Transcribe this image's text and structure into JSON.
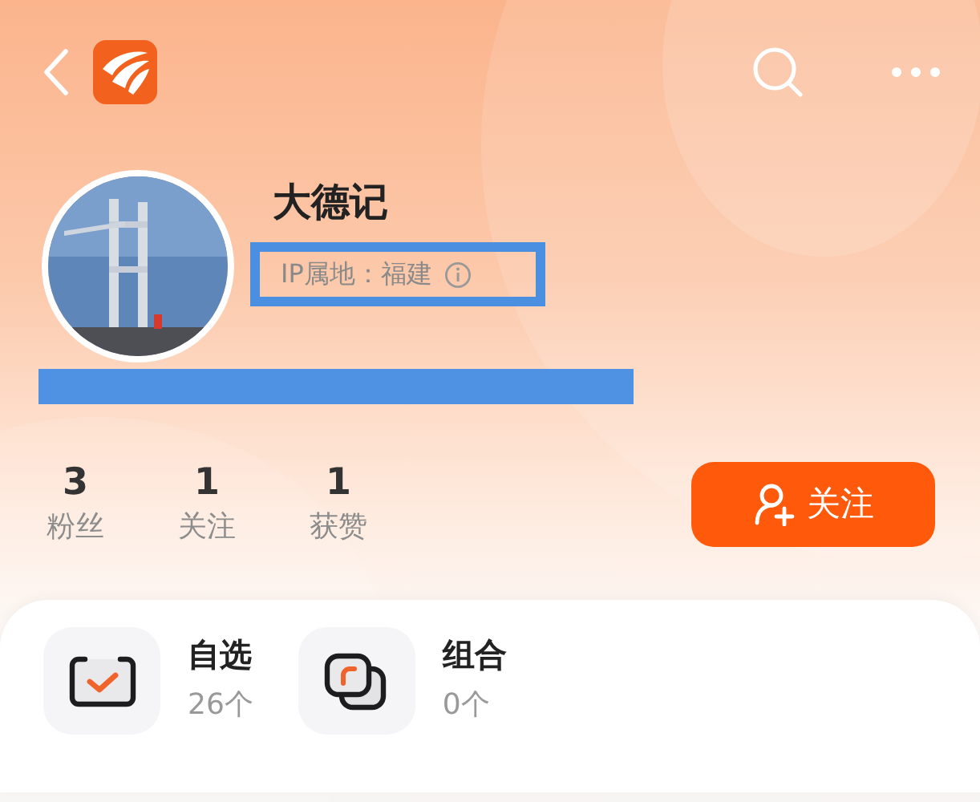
{
  "profile": {
    "name": "大德记",
    "ip_location": "IP属地：福建"
  },
  "stats": [
    {
      "value": "3",
      "label": "粉丝"
    },
    {
      "value": "1",
      "label": "关注"
    },
    {
      "value": "1",
      "label": "获赞"
    }
  ],
  "follow_button": {
    "label": "关注"
  },
  "collections": [
    {
      "kind": "watchlist",
      "title": "自选",
      "count": "26个"
    },
    {
      "kind": "portfolio",
      "title": "组合",
      "count": "0个"
    }
  ]
}
